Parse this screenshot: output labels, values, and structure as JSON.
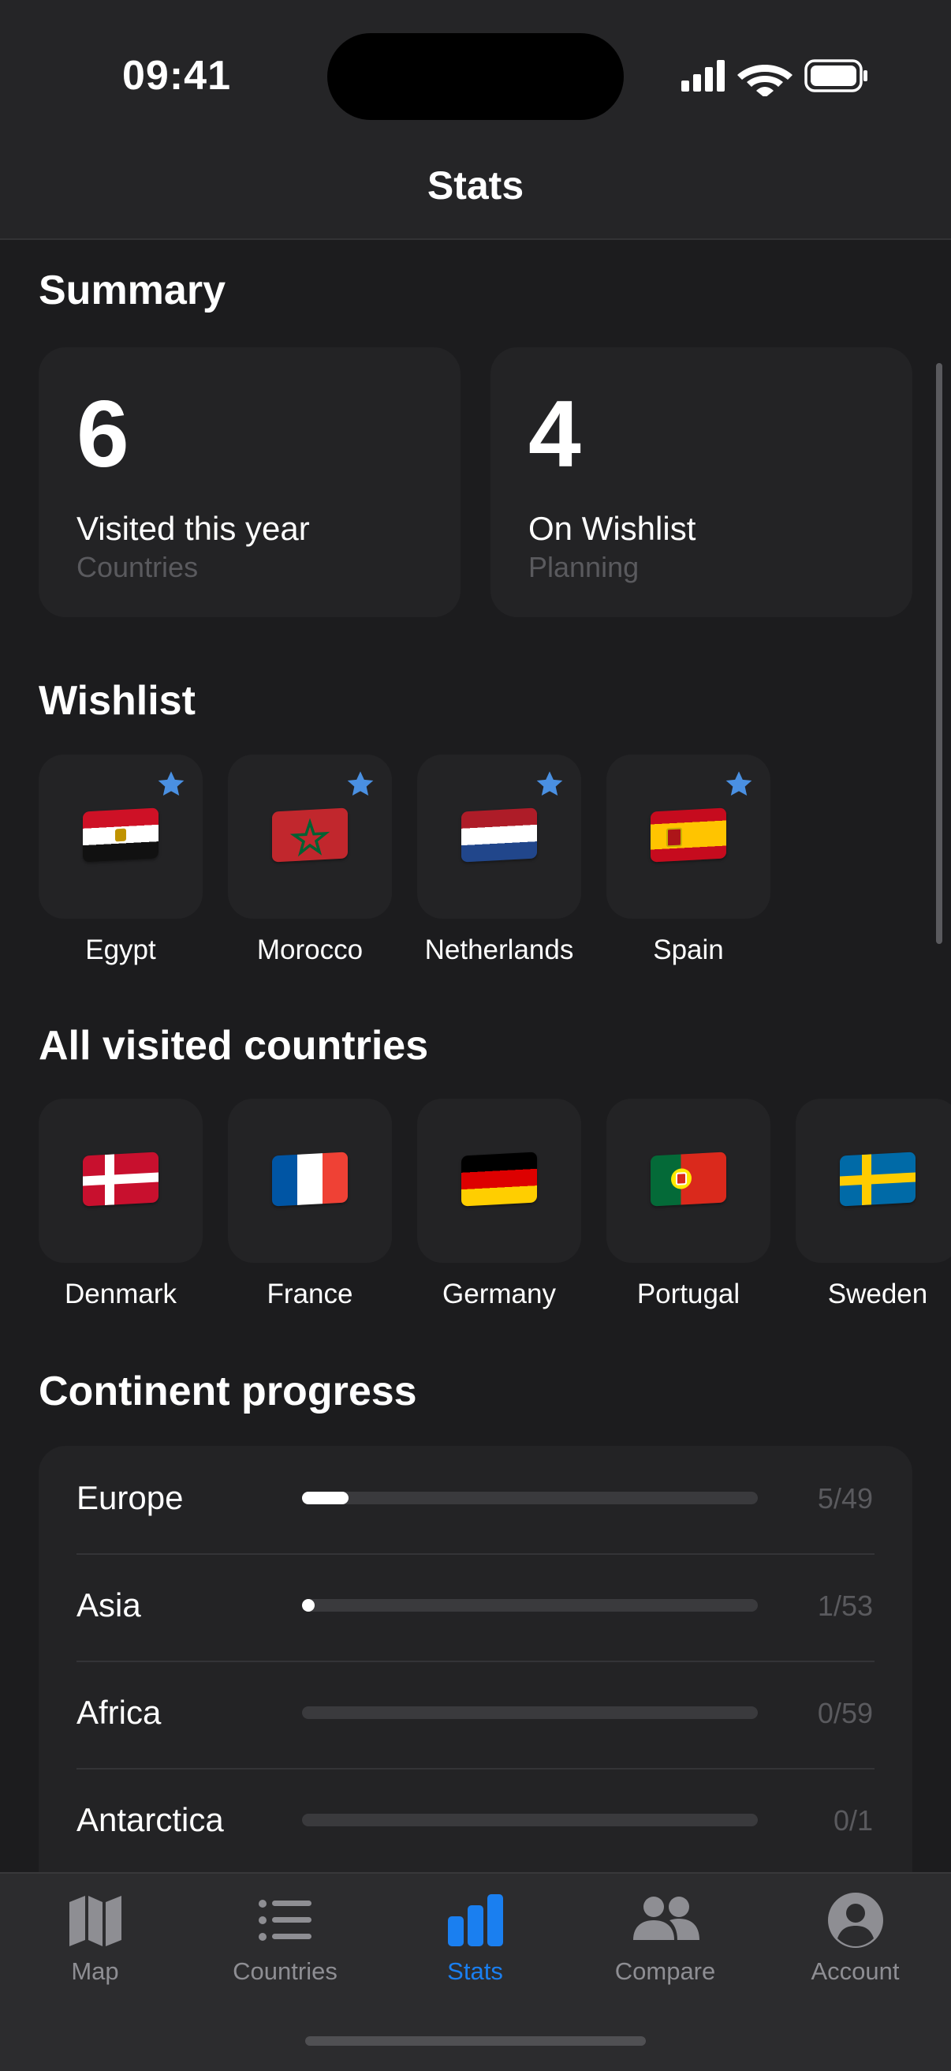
{
  "status_bar": {
    "time": "09:41"
  },
  "nav": {
    "title": "Stats"
  },
  "summary": {
    "title": "Summary",
    "cards": [
      {
        "number": "6",
        "label": "Visited this year",
        "sub": "Countries"
      },
      {
        "number": "4",
        "label": "On Wishlist",
        "sub": "Planning"
      }
    ]
  },
  "wishlist": {
    "title": "Wishlist",
    "items": [
      {
        "name": "Egypt",
        "flag_icon": "egypt-flag-icon",
        "starred": true
      },
      {
        "name": "Morocco",
        "flag_icon": "morocco-flag-icon",
        "starred": true
      },
      {
        "name": "Netherlands",
        "flag_icon": "netherlands-flag-icon",
        "starred": true
      },
      {
        "name": "Spain",
        "flag_icon": "spain-flag-icon",
        "starred": true
      }
    ]
  },
  "visited": {
    "title": "All visited countries",
    "items": [
      {
        "name": "Denmark",
        "flag_icon": "denmark-flag-icon"
      },
      {
        "name": "France",
        "flag_icon": "france-flag-icon"
      },
      {
        "name": "Germany",
        "flag_icon": "germany-flag-icon"
      },
      {
        "name": "Portugal",
        "flag_icon": "portugal-flag-icon"
      },
      {
        "name": "Sweden",
        "flag_icon": "sweden-flag-icon"
      }
    ]
  },
  "continents": {
    "title": "Continent progress",
    "rows": [
      {
        "name": "Europe",
        "count": "5/49",
        "visited": 5,
        "total": 49
      },
      {
        "name": "Asia",
        "count": "1/53",
        "visited": 1,
        "total": 53
      },
      {
        "name": "Africa",
        "count": "0/59",
        "visited": 0,
        "total": 59
      },
      {
        "name": "Antarctica",
        "count": "0/1",
        "visited": 0,
        "total": 1
      }
    ]
  },
  "tabbar": {
    "tabs": [
      {
        "label": "Map",
        "icon": "map-icon",
        "active": false
      },
      {
        "label": "Countries",
        "icon": "list-icon",
        "active": false
      },
      {
        "label": "Stats",
        "icon": "bar-chart-icon",
        "active": true
      },
      {
        "label": "Compare",
        "icon": "people-icon",
        "active": false
      },
      {
        "label": "Account",
        "icon": "account-icon",
        "active": false
      }
    ]
  },
  "colors": {
    "accent": "#1a7ff0",
    "star": "#4a90e2",
    "background": "#1c1c1e",
    "card": "#232325",
    "muted_text": "#5a5a5e"
  }
}
